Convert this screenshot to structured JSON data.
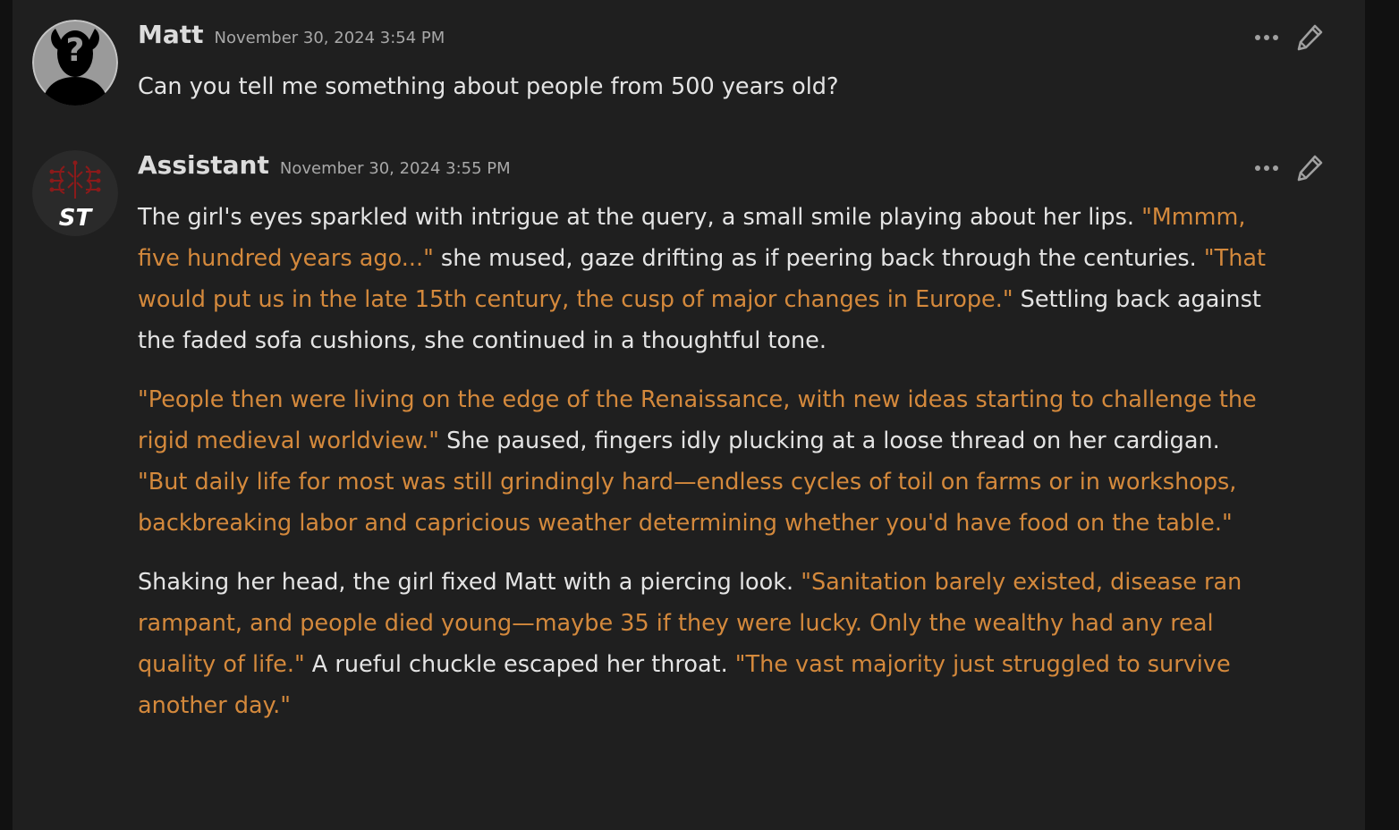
{
  "messages": [
    {
      "name": "Matt",
      "timestamp": "November 30, 2024 3:54 PM",
      "text": "Can you tell me something about people from 500 years old?"
    },
    {
      "name": "Assistant",
      "timestamp": "November 30, 2024 3:55 PM",
      "avatar_label": "ST",
      "paragraphs": [
        [
          {
            "t": "The girl's eyes sparkled with intrigue at the query, a small smile playing about her lips. ",
            "q": false
          },
          {
            "t": "\"Mmmm, five hundred years ago...\"",
            "q": true
          },
          {
            "t": " she mused, gaze drifting as if peering back through the centuries. ",
            "q": false
          },
          {
            "t": "\"That would put us in the late 15th century, the cusp of major changes in Europe.\"",
            "q": true
          },
          {
            "t": " Settling back against the faded sofa cushions, she continued in a thoughtful tone.",
            "q": false
          }
        ],
        [
          {
            "t": "\"People then were living on the edge of the Renaissance, with new ideas starting to challenge the rigid medieval worldview.\"",
            "q": true
          },
          {
            "t": " She paused, fingers idly plucking at a loose thread on her cardigan. ",
            "q": false
          },
          {
            "t": "\"But daily life for most was still grindingly hard—endless cycles of toil on farms or in workshops, backbreaking labor and capricious weather determining whether you'd have food on the table.\"",
            "q": true
          }
        ],
        [
          {
            "t": "Shaking her head, the girl fixed Matt with a piercing look. ",
            "q": false
          },
          {
            "t": "\"Sanitation barely existed, disease ran rampant, and people died young—maybe 35 if they were lucky. Only the wealthy had any real quality of life.\"",
            "q": true
          },
          {
            "t": " A rueful chuckle escaped her throat. ",
            "q": false
          },
          {
            "t": "\"The vast majority just struggled to survive another day.\"",
            "q": true
          }
        ]
      ]
    }
  ],
  "colors": {
    "background": "#1f1f1f",
    "text": "#e4e4e4",
    "quote": "#d4893c",
    "timestamp": "#a8a8a8"
  },
  "icons": {
    "more": "ellipsis-icon",
    "edit": "pencil-icon"
  }
}
